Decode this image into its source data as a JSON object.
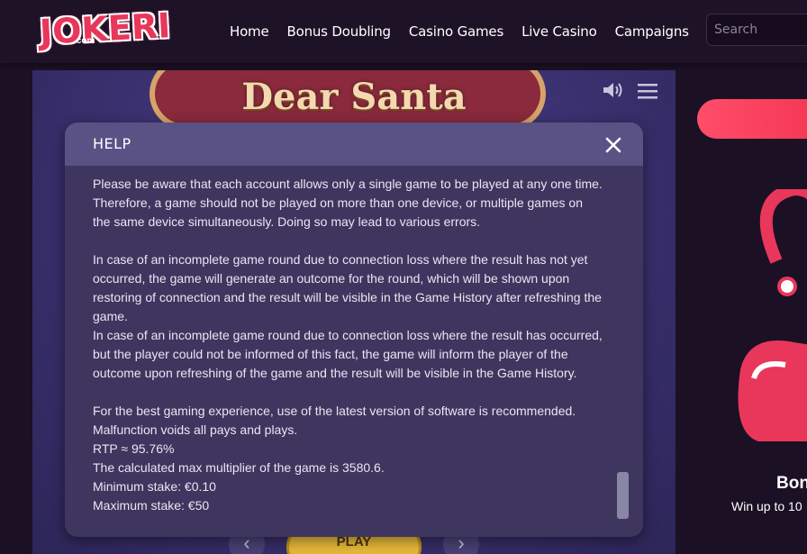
{
  "brand": {
    "logo_text": "JOKERI",
    "logo_sub": ".com"
  },
  "nav": {
    "items": [
      {
        "label": "Home"
      },
      {
        "label": "Bonus Doubling"
      },
      {
        "label": "Casino Games"
      },
      {
        "label": "Live Casino"
      },
      {
        "label": "Campaigns"
      }
    ]
  },
  "search": {
    "placeholder": "Search"
  },
  "game": {
    "title": "Dear Santa",
    "play_label": "PLAY"
  },
  "help_modal": {
    "title": "HELP",
    "paragraphs": [
      "Please be aware that each account allows only a single game to be played at any one time.\nTherefore, a game should not be played on more than one device, or multiple games on\nthe same device simultaneously. Doing so may lead to various errors.",
      "In case of an incomplete game round due to connection loss where the result has not yet\noccurred, the game will generate an outcome for the round, which will be shown upon\nrestoring of connection and the result will be visible in the Game History after refreshing the\ngame.",
      "In case of an incomplete game round due to connection loss where the result has occurred,\nbut the player could not be informed of this fact, the game will inform the player of the\noutcome upon refreshing of the game and the result will be visible in the Game History.",
      "For the best gaming experience, use of the latest version of software is recommended.\nMalfunction voids all pays and plays.",
      "RTP ≈ 95.76%",
      "The calculated max multiplier of the game is 3580.6.",
      "Minimum stake: €0.10",
      "Maximum stake: €50"
    ]
  },
  "promo": {
    "title": "Bon",
    "subtitle": "Win up to 10"
  },
  "colors": {
    "accent": "#e8375a",
    "page_bg": "#1b1024",
    "modal_bg": "#3e365f",
    "modal_header": "#5a5185"
  },
  "icons": [
    "speaker-icon",
    "menu-icon",
    "close-icon",
    "chevron-left-icon",
    "chevron-right-icon"
  ]
}
